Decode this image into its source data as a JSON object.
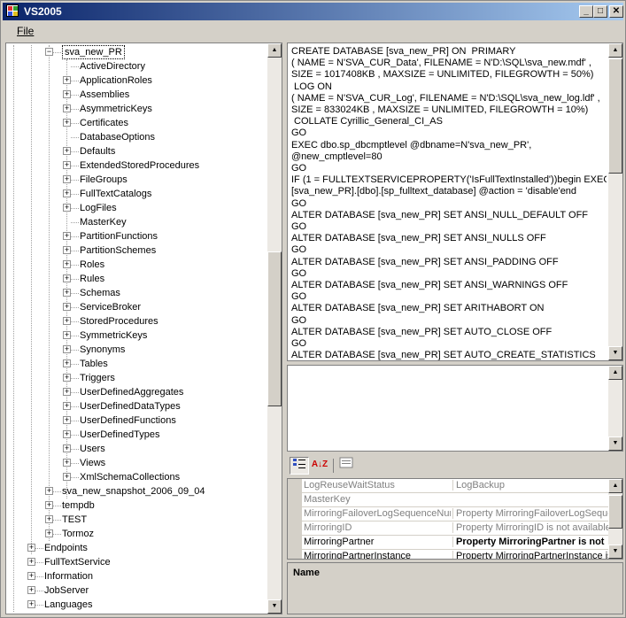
{
  "window": {
    "title": "VS2005",
    "min": "_",
    "max": "□",
    "close": "✕"
  },
  "menu": {
    "file_label": "File"
  },
  "tree": {
    "selected": "sva_new_PR",
    "children": [
      {
        "label": "ActiveDirectory",
        "expandable": false
      },
      {
        "label": "ApplicationRoles",
        "expandable": true
      },
      {
        "label": "Assemblies",
        "expandable": true
      },
      {
        "label": "AsymmetricKeys",
        "expandable": true
      },
      {
        "label": "Certificates",
        "expandable": true
      },
      {
        "label": "DatabaseOptions",
        "expandable": false
      },
      {
        "label": "Defaults",
        "expandable": true
      },
      {
        "label": "ExtendedStoredProcedures",
        "expandable": true
      },
      {
        "label": "FileGroups",
        "expandable": true
      },
      {
        "label": "FullTextCatalogs",
        "expandable": true
      },
      {
        "label": "LogFiles",
        "expandable": true
      },
      {
        "label": "MasterKey",
        "expandable": false
      },
      {
        "label": "PartitionFunctions",
        "expandable": true
      },
      {
        "label": "PartitionSchemes",
        "expandable": true
      },
      {
        "label": "Roles",
        "expandable": true
      },
      {
        "label": "Rules",
        "expandable": true
      },
      {
        "label": "Schemas",
        "expandable": true
      },
      {
        "label": "ServiceBroker",
        "expandable": true
      },
      {
        "label": "StoredProcedures",
        "expandable": true
      },
      {
        "label": "SymmetricKeys",
        "expandable": true
      },
      {
        "label": "Synonyms",
        "expandable": true
      },
      {
        "label": "Tables",
        "expandable": true
      },
      {
        "label": "Triggers",
        "expandable": true
      },
      {
        "label": "UserDefinedAggregates",
        "expandable": true
      },
      {
        "label": "UserDefinedDataTypes",
        "expandable": true
      },
      {
        "label": "UserDefinedFunctions",
        "expandable": true
      },
      {
        "label": "UserDefinedTypes",
        "expandable": true
      },
      {
        "label": "Users",
        "expandable": true
      },
      {
        "label": "Views",
        "expandable": true
      },
      {
        "label": "XmlSchemaCollections",
        "expandable": true
      }
    ],
    "siblings": [
      "sva_new_snapshot_2006_09_04",
      "tempdb",
      "TEST",
      "Tormoz"
    ],
    "top_level": [
      "Endpoints",
      "FullTextService",
      "Information",
      "JobServer",
      "Languages"
    ]
  },
  "sql_lines": [
    "CREATE DATABASE [sva_new_PR] ON  PRIMARY",
    "( NAME = N'SVA_CUR_Data', FILENAME = N'D:\\SQL\\sva_new.mdf' ,",
    "SIZE = 1017408KB , MAXSIZE = UNLIMITED, FILEGROWTH = 50%)",
    " LOG ON",
    "( NAME = N'SVA_CUR_Log', FILENAME = N'D:\\SQL\\sva_new_log.ldf' ,",
    "SIZE = 833024KB , MAXSIZE = UNLIMITED, FILEGROWTH = 10%)",
    " COLLATE Cyrillic_General_CI_AS",
    "GO",
    "EXEC dbo.sp_dbcmptlevel @dbname=N'sva_new_PR',",
    "@new_cmptlevel=80",
    "GO",
    "IF (1 = FULLTEXTSERVICEPROPERTY('IsFullTextInstalled'))begin EXEC",
    "[sva_new_PR].[dbo].[sp_fulltext_database] @action = 'disable'end",
    "GO",
    "ALTER DATABASE [sva_new_PR] SET ANSI_NULL_DEFAULT OFF",
    "GO",
    "ALTER DATABASE [sva_new_PR] SET ANSI_NULLS OFF",
    "GO",
    "ALTER DATABASE [sva_new_PR] SET ANSI_PADDING OFF",
    "GO",
    "ALTER DATABASE [sva_new_PR] SET ANSI_WARNINGS OFF",
    "GO",
    "ALTER DATABASE [sva_new_PR] SET ARITHABORT ON",
    "GO",
    "ALTER DATABASE [sva_new_PR] SET AUTO_CLOSE OFF",
    "GO",
    "ALTER DATABASE [sva_new_PR] SET AUTO_CREATE_STATISTICS"
  ],
  "property_toolbar": {
    "categorized_icon": "categorized-icon",
    "alphabetical_icon": "alphabetical-icon",
    "pages_icon": "property-pages-icon",
    "alpha_text": "A↓Z"
  },
  "properties": [
    {
      "name": "LogReuseWaitStatus",
      "value": "LogBackup",
      "style": "gray"
    },
    {
      "name": "MasterKey",
      "value": "",
      "style": "gray"
    },
    {
      "name": "MirroringFailoverLogSequenceNumber",
      "value": "Property MirroringFailoverLogSequenceNumber",
      "style": "gray"
    },
    {
      "name": "MirroringID",
      "value": "Property MirroringID is not available for",
      "style": "gray"
    },
    {
      "name": "MirroringPartner",
      "value": "Property MirroringPartner is not",
      "style": "bold"
    },
    {
      "name": "MirroringPartnerInstance",
      "value": "Property MirroringPartnerInstance is not",
      "style": "normal"
    }
  ],
  "description": {
    "title": "Name"
  }
}
